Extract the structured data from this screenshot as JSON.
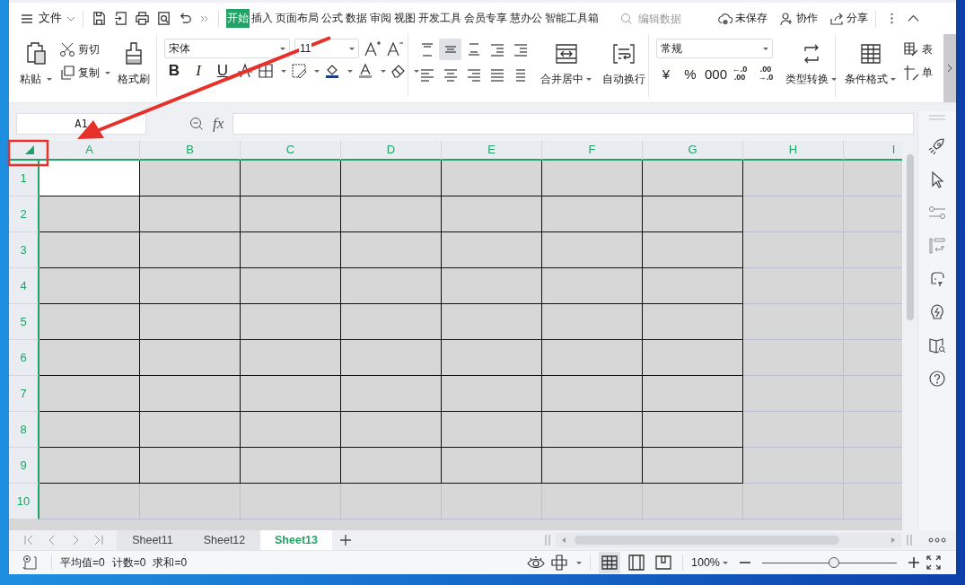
{
  "top_bar": {
    "menu": "文件",
    "tabs": [
      {
        "label": "开始",
        "selected": true
      },
      {
        "label": "插入",
        "selected": false
      },
      {
        "label": "页面布局",
        "selected": false
      },
      {
        "label": "公式",
        "selected": false
      },
      {
        "label": "数据",
        "selected": false
      },
      {
        "label": "审阅",
        "selected": false
      },
      {
        "label": "视图",
        "selected": false
      },
      {
        "label": "开发工具",
        "selected": false
      },
      {
        "label": "会员专享",
        "selected": false
      },
      {
        "label": "慧办公",
        "selected": false
      },
      {
        "label": "智能工具箱",
        "selected": false
      }
    ],
    "search": {
      "placeholder": "编辑数据"
    },
    "actions": [
      {
        "kind": "cloud",
        "label": "未保存"
      },
      {
        "kind": "collab",
        "label": "协作"
      },
      {
        "kind": "share",
        "label": "分享"
      }
    ]
  },
  "ribbon": {
    "clipboard": {
      "paste": "粘贴",
      "cut": "剪切",
      "copy": "复制",
      "format_painter": "格式刷"
    },
    "font": {
      "family": "宋体",
      "size": "11",
      "styles": [
        {
          "text": "B",
          "kind": "bold"
        },
        {
          "text": "I",
          "kind": "italic"
        },
        {
          "text": "U",
          "kind": "underline"
        },
        {
          "kind": "strike"
        }
      ]
    },
    "alignment": {
      "buttons": [
        {
          "kind": "top",
          "selected": false
        },
        {
          "kind": "middle",
          "selected": true
        },
        {
          "kind": "bottom",
          "selected": false
        },
        {
          "kind": "outdent",
          "selected": false
        },
        {
          "kind": "indent",
          "selected": false
        },
        {
          "kind": "left",
          "selected": false
        },
        {
          "kind": "center",
          "selected": false
        },
        {
          "kind": "right",
          "selected": false
        },
        {
          "kind": "justify",
          "selected": false
        },
        {
          "kind": "distributed",
          "selected": false
        }
      ],
      "merge": "合并居中",
      "wrap": "自动换行"
    },
    "number": {
      "format": "常规",
      "symbols": [
        "¥",
        "%",
        "000"
      ],
      "decimals": [
        [
          "←.0",
          ".00"
        ],
        [
          ".00",
          "→.0"
        ]
      ],
      "convert": "类型转换"
    },
    "styles": {
      "conditional": "条件格式",
      "table": "表",
      "cell": "单"
    }
  },
  "formula_bar": {
    "name_box": "A1",
    "fx": "fx"
  },
  "sheet": {
    "columns": [
      {
        "label": "A",
        "bordered": true,
        "active": true
      },
      {
        "label": "B",
        "bordered": true,
        "active": false
      },
      {
        "label": "C",
        "bordered": true,
        "active": false
      },
      {
        "label": "D",
        "bordered": true,
        "active": false
      },
      {
        "label": "E",
        "bordered": true,
        "active": false
      },
      {
        "label": "F",
        "bordered": true,
        "active": false
      },
      {
        "label": "G",
        "bordered": true,
        "active": false
      },
      {
        "label": "H",
        "bordered": false,
        "active": false
      },
      {
        "label": "I",
        "bordered": false,
        "active": false
      }
    ],
    "rows": [
      {
        "label": "1",
        "bordered": true,
        "active": true
      },
      {
        "label": "2",
        "bordered": true,
        "active": false
      },
      {
        "label": "3",
        "bordered": true,
        "active": false
      },
      {
        "label": "4",
        "bordered": true,
        "active": false
      },
      {
        "label": "5",
        "bordered": true,
        "active": false
      },
      {
        "label": "6",
        "bordered": true,
        "active": false
      },
      {
        "label": "7",
        "bordered": true,
        "active": false
      },
      {
        "label": "8",
        "bordered": true,
        "active": false
      },
      {
        "label": "9",
        "bordered": true,
        "active": false
      },
      {
        "label": "10",
        "bordered": false,
        "active": false
      }
    ]
  },
  "sheet_tabs": [
    {
      "label": "Sheet11",
      "selected": false
    },
    {
      "label": "Sheet12",
      "selected": false
    },
    {
      "label": "Sheet13",
      "selected": true
    }
  ],
  "status_bar": {
    "summary": [
      "平均值=0",
      "计数=0",
      "求和=0"
    ],
    "zoom": "100%",
    "zoom_slider": {
      "level": 0.53
    }
  }
}
